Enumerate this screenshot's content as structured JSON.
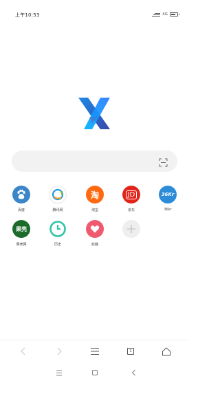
{
  "status_bar": {
    "time": "上午10:53",
    "network": "4G",
    "signal_icon": "signal-icon",
    "battery_level": 0.55
  },
  "logo": {
    "icon": "x-browser-logo-icon",
    "colors": [
      "#1a73e8",
      "#2196f3",
      "#3f51b5"
    ]
  },
  "search": {
    "placeholder": "",
    "scan_icon": "scan-icon"
  },
  "shortcuts": [
    {
      "label": "百度",
      "icon": "baidu-paw-icon",
      "color": "#3a86c8"
    },
    {
      "label": "腾讯网",
      "icon": "tencent-icon",
      "color": "#ffffff"
    },
    {
      "label": "淘宝",
      "icon_text": "淘",
      "icon": "taobao-icon",
      "color": "#ff6a10"
    },
    {
      "label": "京东",
      "icon_text": "JD",
      "icon": "jd-icon",
      "color": "#e1251b"
    },
    {
      "label": "36kr",
      "icon_text": "36Kr",
      "icon": "36kr-icon",
      "color": "#2d8cd8"
    },
    {
      "label": "果壳网",
      "icon_text": "果壳",
      "icon": "guokr-icon",
      "color": "#1c6b2a"
    },
    {
      "label": "历史",
      "icon": "history-clock-icon",
      "color": "#2ec4a6"
    },
    {
      "label": "收藏",
      "icon": "favorites-heart-icon",
      "color": "#ef5b6e"
    },
    {
      "label": "",
      "icon": "add-shortcut-icon",
      "color": "#eeeeee"
    }
  ],
  "toolbar": {
    "back_icon": "back-arrow-icon",
    "forward_icon": "forward-arrow-icon",
    "menu_icon": "menu-icon",
    "tab_count": "1",
    "home_icon": "home-icon"
  },
  "navbar": {
    "recents_icon": "recents-icon",
    "home_icon": "nav-home-icon",
    "back_icon": "nav-back-icon"
  }
}
